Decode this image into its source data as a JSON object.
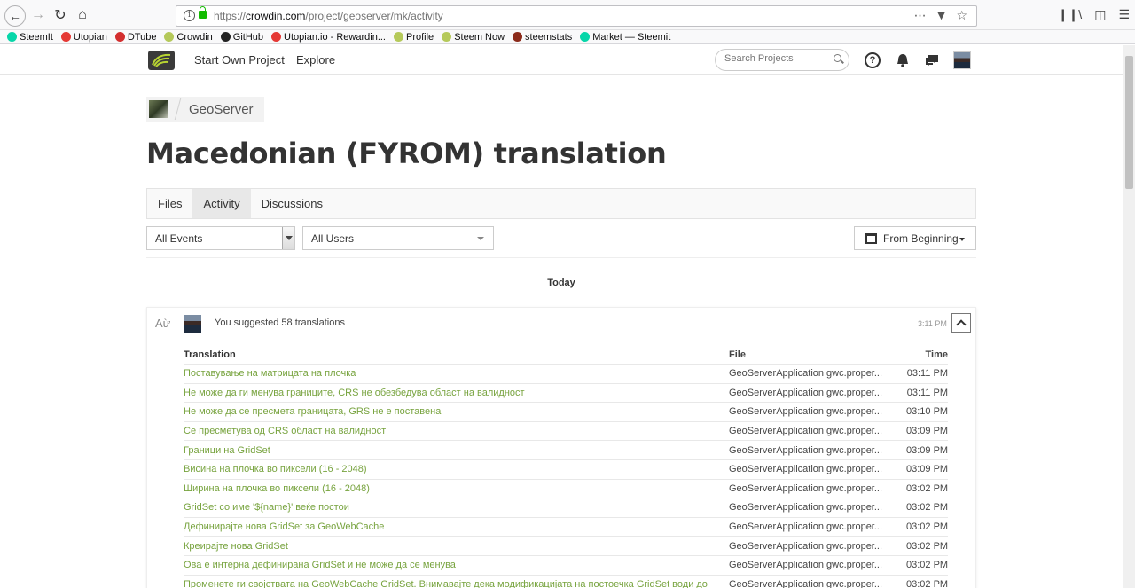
{
  "browser": {
    "url_prefix": "https://",
    "url_host": "crowdin.com",
    "url_path": "/project/geoserver/mk/activity",
    "bookmarks": [
      {
        "label": "SteemIt",
        "color": "#06d6a9"
      },
      {
        "label": "Utopian",
        "color": "#e53935"
      },
      {
        "label": "DTube",
        "color": "#d32f2f"
      },
      {
        "label": "Crowdin",
        "color": "#b5c95a"
      },
      {
        "label": "GitHub",
        "color": "#222222"
      },
      {
        "label": "Utopian.io - Rewardin...",
        "color": "#e53935"
      },
      {
        "label": "Profile",
        "color": "#b5c95a"
      },
      {
        "label": "Steem Now",
        "color": "#b5c95a"
      },
      {
        "label": "steemstats",
        "color": "#8b2a1a"
      },
      {
        "label": "Market — Steemit",
        "color": "#06d6a9"
      }
    ]
  },
  "header": {
    "nav": [
      "Start Own Project",
      "Explore"
    ],
    "search_placeholder": "Search Projects",
    "help_symbol": "?"
  },
  "project": {
    "name": "GeoServer",
    "title": "Macedonian (FYROM) translation",
    "tabs": [
      "Files",
      "Activity",
      "Discussions"
    ],
    "active_tab": "Activity"
  },
  "filters": {
    "events": "All Events",
    "users": "All Users",
    "from": "From Beginning"
  },
  "activity": {
    "day": "Today",
    "summary": "You suggested 58 translations",
    "time": "3:11 PM",
    "columns": {
      "translation": "Translation",
      "file": "File",
      "time": "Time"
    },
    "rows": [
      {
        "text": "Поставување на матрицата на плочка",
        "file": "GeoServerApplication gwc.proper...",
        "time": "03:11 PM"
      },
      {
        "text": "Не може да ги менува границите, CRS не обезбедува област на валидност",
        "file": "GeoServerApplication gwc.proper...",
        "time": "03:11 PM"
      },
      {
        "text": "Не може да се пресмета границата, GRS не е поставена",
        "file": "GeoServerApplication gwc.proper...",
        "time": "03:10 PM"
      },
      {
        "text": "Се пресметува од CRS област на валидност",
        "file": "GeoServerApplication gwc.proper...",
        "time": "03:09 PM"
      },
      {
        "text": "Граници на GridSet",
        "file": "GeoServerApplication gwc.proper...",
        "time": "03:09 PM"
      },
      {
        "text": "Висина на плочка во пиксели (16 - 2048)",
        "file": "GeoServerApplication gwc.proper...",
        "time": "03:09 PM"
      },
      {
        "text": "Ширина на плочка во пиксели (16 - 2048)",
        "file": "GeoServerApplication gwc.proper...",
        "time": "03:02 PM"
      },
      {
        "text": "GridSet со име '${name}' веќе постои",
        "file": "GeoServerApplication gwc.proper...",
        "time": "03:02 PM"
      },
      {
        "text": "Дефинирајте нова GridSet за GeoWebCache",
        "file": "GeoServerApplication gwc.proper...",
        "time": "03:02 PM"
      },
      {
        "text": "Креирајте нова GridSet",
        "file": "GeoServerApplication gwc.proper...",
        "time": "03:02 PM"
      },
      {
        "text": "Ова е интерна дефинирана GridSet и не може да се менува",
        "file": "GeoServerApplication gwc.proper...",
        "time": "03:02 PM"
      },
      {
        "text": "Променете ги својствата на GeoWebCache GridSet. Внимавајте дека модификацијата на постоечка GridSet води до",
        "file": "GeoServerApplication gwc.proper...",
        "time": "03:02 PM"
      }
    ]
  }
}
